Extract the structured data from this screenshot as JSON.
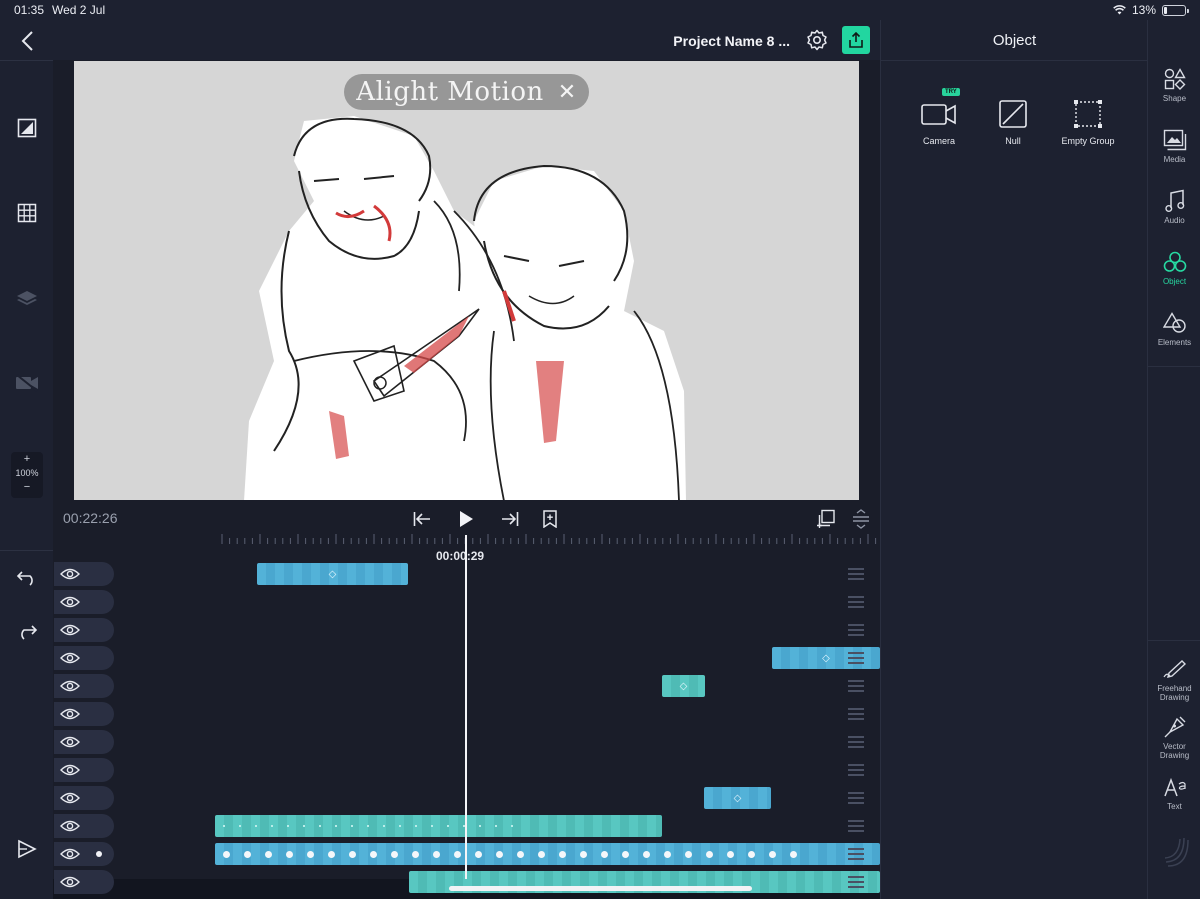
{
  "status_bar": {
    "time": "01:35",
    "date": "Wed 2 Jul",
    "battery": "13%"
  },
  "header": {
    "project_name": "Project Name 8 ..."
  },
  "canvas": {
    "watermark_text": "Alight Motion",
    "watermark_close": "✕"
  },
  "left_rail": {
    "zoom_plus": "+",
    "zoom_level": "100%",
    "zoom_minus": "−"
  },
  "object_panel": {
    "title": "Object",
    "items": [
      {
        "label": "Camera",
        "badge": "TRY"
      },
      {
        "label": "Null"
      },
      {
        "label": "Empty Group"
      }
    ]
  },
  "right_rail": {
    "items": [
      {
        "label": "Shape",
        "icon": "shape-icon"
      },
      {
        "label": "Media",
        "icon": "media-icon"
      },
      {
        "label": "Audio",
        "icon": "music-icon"
      },
      {
        "label": "Object",
        "icon": "object-icon",
        "active": true
      },
      {
        "label": "Elements",
        "icon": "elements-icon"
      },
      {
        "label": "Freehand Drawing",
        "icon": "freehand-icon"
      },
      {
        "label": "Vector Drawing",
        "icon": "vector-pen-icon"
      },
      {
        "label": "Text",
        "icon": "text-icon"
      }
    ]
  },
  "timeline": {
    "current_time_left": "00:22:26",
    "playhead_time": "00:00:29",
    "keyframe_glyph": "◇",
    "layer_count": 12
  },
  "colors": {
    "accent": "#27d9a1",
    "clip_blue": "#53b2d8",
    "clip_teal": "#58c7c1",
    "background": "#1d2130"
  }
}
